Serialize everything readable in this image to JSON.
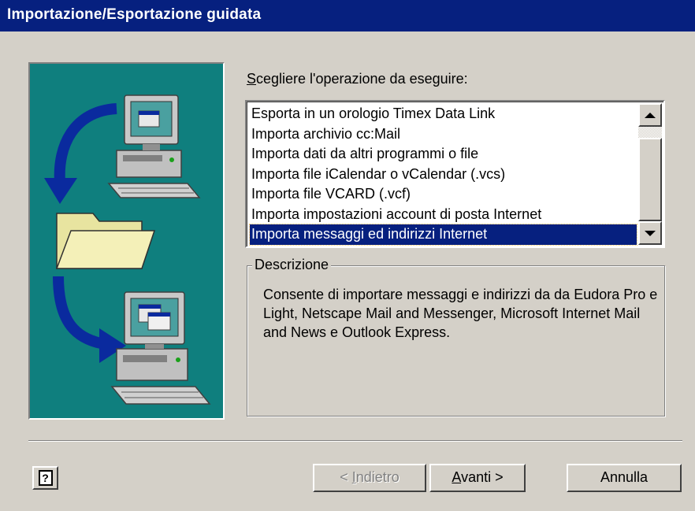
{
  "window": {
    "title": "Importazione/Esportazione guidata"
  },
  "prompt": {
    "access_key": "S",
    "rest": "cegliere l'operazione da eseguire:"
  },
  "list": {
    "items": [
      "Esporta in un orologio Timex Data Link",
      "Importa archivio cc:Mail",
      "Importa dati da altri programmi o file",
      "Importa file iCalendar o vCalendar (.vcs)",
      "Importa file VCARD (.vcf)",
      "Importa impostazioni account di posta Internet",
      "Importa messaggi ed indirizzi Internet"
    ],
    "selected_index": 6
  },
  "description": {
    "legend": "Descrizione",
    "text": "Consente di importare messaggi e indirizzi da da Eudora Pro e Light, Netscape Mail and Messenger, Microsoft Internet Mail and News e Outlook Express."
  },
  "buttons": {
    "help_glyph": "?",
    "back": {
      "prefix": "< ",
      "access_key": "I",
      "rest": "ndietro",
      "enabled": false
    },
    "next": {
      "access_key": "A",
      "rest": "vanti >",
      "enabled": true
    },
    "cancel": {
      "label": "Annulla",
      "enabled": true
    }
  },
  "colors": {
    "title_bar": "#06207f",
    "dialog_face": "#d4d0c8",
    "art_panel": "#0f7f7e",
    "selection": "#06207f"
  },
  "icons": [
    "computer-icon",
    "folder-icon",
    "arrow-icon",
    "help-icon",
    "scroll-up-arrow-icon",
    "scroll-down-arrow-icon"
  ]
}
